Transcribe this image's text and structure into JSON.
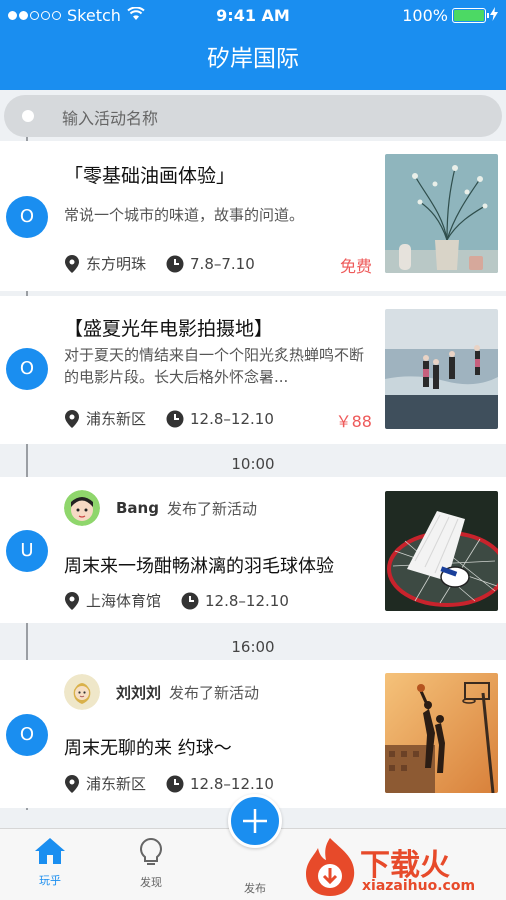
{
  "status_bar": {
    "carrier": "Sketch",
    "time": "9:41 AM",
    "battery": "100%"
  },
  "nav": {
    "title": "矽岸国际"
  },
  "search": {
    "placeholder": "输入活动名称"
  },
  "feed": [
    {
      "node": "O",
      "title": "「零基础油画体验」",
      "desc": "常说一个城市的味道，故事的问道。",
      "location": "东方明珠",
      "date": "7.8–7.10",
      "price": "免费"
    },
    {
      "node": "O",
      "title": "【盛夏光年电影拍摄地】",
      "desc": "对于夏天的情结来自一个个阳光炙热蝉鸣不断的电影片段。长大后格外怀念暑...",
      "location": "浦东新区",
      "date": "12.8–12.10",
      "price": "￥88"
    },
    {
      "time_separator": "10:00",
      "node": "U",
      "user": "Bang",
      "action": "发布了新活动",
      "title": "周末来一场酣畅淋漓的羽毛球体验",
      "location": "上海体育馆",
      "date": "12.8–12.10"
    },
    {
      "time_separator": "16:00",
      "node": "O",
      "user": "刘刘刘",
      "action": "发布了新活动",
      "title": "周末无聊的来 约球～",
      "location": "浦东新区",
      "date": "12.8–12.10"
    }
  ],
  "tabbar": {
    "items": [
      "玩乎",
      "发现",
      "发布"
    ]
  },
  "watermark": {
    "cn": "下载火",
    "en": "xiazaihuo.com"
  },
  "colors": {
    "primary": "#1a8ef0",
    "price": "#ee5a5a",
    "watermark": "#e74a2a"
  }
}
